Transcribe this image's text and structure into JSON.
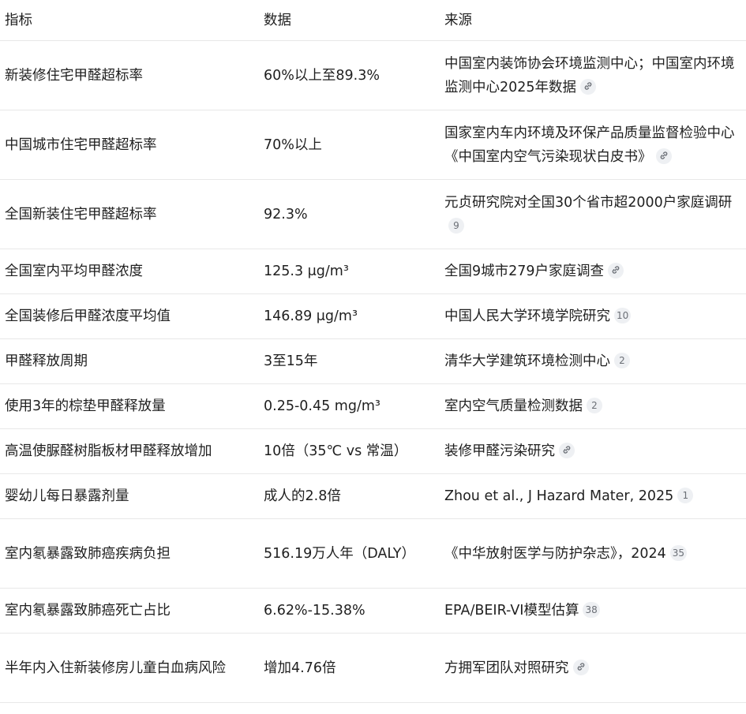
{
  "table": {
    "headers": [
      "指标",
      "数据",
      "来源"
    ],
    "rows": [
      {
        "indicator": "新装修住宅甲醛超标率",
        "value": "60%以上至89.3%",
        "source": "中国室内装饰协会环境监测中心；中国室内环境监测中心2025年数据",
        "citation": {
          "type": "link-icon"
        }
      },
      {
        "indicator": "中国城市住宅甲醛超标率",
        "value": "70%以上",
        "source": "国家室内车内环境及环保产品质量监督检验中心《中国室内空气污染现状白皮书》",
        "citation": {
          "type": "link-icon"
        }
      },
      {
        "indicator": "全国新装住宅甲醛超标率",
        "value": "92.3%",
        "source": "元贞研究院对全国30个省市超2000户家庭调研",
        "citation": {
          "type": "number",
          "text": "9"
        }
      },
      {
        "indicator": "全国室内平均甲醛浓度",
        "value": "125.3 μg/m³",
        "source": "全国9城市279户家庭调查",
        "citation": {
          "type": "link-icon"
        }
      },
      {
        "indicator": "全国装修后甲醛浓度平均值",
        "value": "146.89 μg/m³",
        "source": "中国人民大学环境学院研究",
        "citation": {
          "type": "number",
          "text": "10"
        }
      },
      {
        "indicator": "甲醛释放周期",
        "value": "3至15年",
        "source": "清华大学建筑环境检测中心",
        "citation": {
          "type": "number",
          "text": "2"
        }
      },
      {
        "indicator": "使用3年的棕垫甲醛释放量",
        "value": "0.25-0.45 mg/m³",
        "source": "室内空气质量检测数据",
        "citation": {
          "type": "number",
          "text": "2"
        }
      },
      {
        "indicator": "高温使脲醛树脂板材甲醛释放增加",
        "value": "10倍（35℃ vs 常温）",
        "source": "装修甲醛污染研究",
        "citation": {
          "type": "link-icon"
        }
      },
      {
        "indicator": "婴幼儿每日暴露剂量",
        "value": "成人的2.8倍",
        "source": "Zhou et al., J Hazard Mater, 2025",
        "citation": {
          "type": "number",
          "text": "1"
        }
      },
      {
        "indicator": "室内氡暴露致肺癌疾病负担",
        "value": "516.19万人年（DALY）",
        "source": "《中华放射医学与防护杂志》，2024",
        "citation": {
          "type": "number",
          "text": "35"
        }
      },
      {
        "indicator": "室内氡暴露致肺癌死亡占比",
        "value": "6.62%-15.38%",
        "source": "EPA/BEIR-VI模型估算",
        "citation": {
          "type": "number",
          "text": "38"
        }
      },
      {
        "indicator": "半年内入住新装修房儿童白血病风险",
        "value": "增加4.76倍",
        "source": "方拥军团队对照研究",
        "citation": {
          "type": "link-icon"
        }
      }
    ]
  }
}
